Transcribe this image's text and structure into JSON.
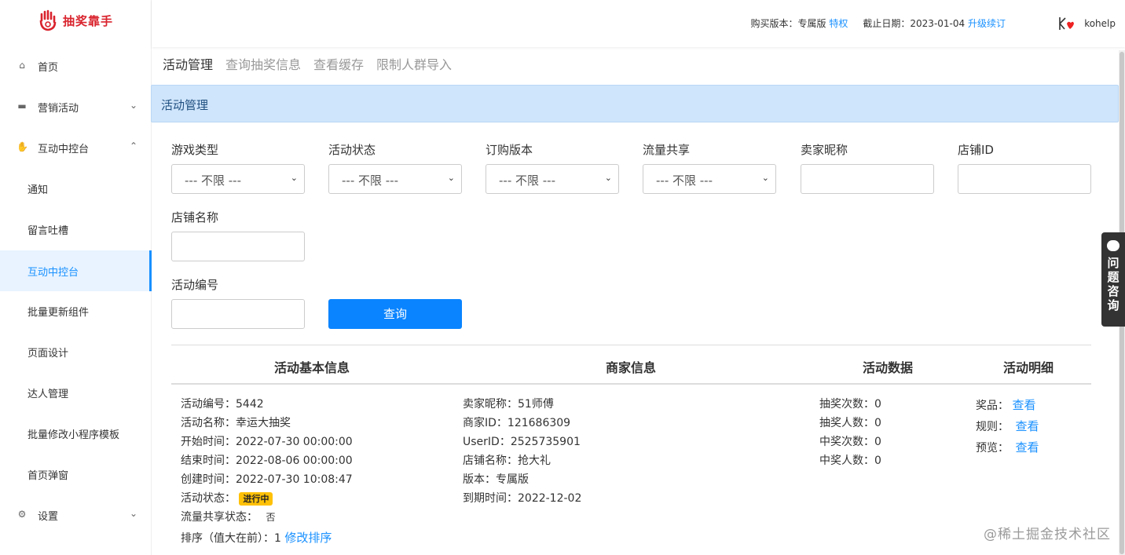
{
  "app": {
    "logo_text": "抽奖靠手"
  },
  "topbar": {
    "version_label": "购买版本：专属版",
    "privilege_link": "特权",
    "expire_label": "截止日期：2023-01-04",
    "renew_link": "升级续订",
    "username": "kohelp"
  },
  "sidebar": {
    "items": [
      {
        "label": "首页",
        "icon": "home-icon"
      },
      {
        "label": "营销活动",
        "icon": "briefcase-icon"
      },
      {
        "label": "互动中控台",
        "icon": "thumbs-up-icon"
      },
      {
        "label": "通知"
      },
      {
        "label": "留言吐槽"
      },
      {
        "label": "互动中控台"
      },
      {
        "label": "批量更新组件"
      },
      {
        "label": "页面设计"
      },
      {
        "label": "达人管理"
      },
      {
        "label": "批量修改小程序模板"
      },
      {
        "label": "首页弹窗"
      },
      {
        "label": "设置",
        "icon": "gear-icon"
      }
    ]
  },
  "tabs": [
    "活动管理",
    "查询抽奖信息",
    "查看缓存",
    "限制人群导入"
  ],
  "panel": {
    "title": "活动管理"
  },
  "filters": {
    "game_type": {
      "label": "游戏类型",
      "value": "--- 不限 ---"
    },
    "activity_status": {
      "label": "活动状态",
      "value": "--- 不限 ---"
    },
    "subscription_version": {
      "label": "订购版本",
      "value": "--- 不限 ---"
    },
    "traffic_share": {
      "label": "流量共享",
      "value": "--- 不限 ---"
    },
    "seller_nick": {
      "label": "卖家昵称",
      "value": ""
    },
    "shop_id": {
      "label": "店铺ID",
      "value": ""
    },
    "shop_name": {
      "label": "店铺名称",
      "value": ""
    },
    "activity_no": {
      "label": "活动编号",
      "value": ""
    },
    "query_button": "查询"
  },
  "table": {
    "headers": [
      "活动基本信息",
      "商家信息",
      "活动数据",
      "活动明细"
    ],
    "row": {
      "basic": {
        "activity_no": "活动编号：5442",
        "activity_name": "活动名称：幸运大抽奖",
        "start_time": "开始时间：2022-07-30 00:00:00",
        "end_time": "结束时间：2022-08-06 00:00:00",
        "created_time": "创建时间：2022-07-30 10:08:47",
        "status_label": "活动状态：",
        "status_badge": "进行中",
        "traffic_label": "流量共享状态：",
        "traffic_value": "否",
        "sort_label": "排序（值大在前）：1",
        "sort_link": "修改排序"
      },
      "merchant": {
        "nick": "卖家昵称：51师傅",
        "merchant_id": "商家ID：121686309",
        "user_id": "UserID：2525735901",
        "shop_name": "店铺名称：抢大礼",
        "version": "版本：专属版",
        "expire": "到期时间：2022-12-02"
      },
      "data": {
        "draw_times": "抽奖次数：0",
        "draw_people": "抽奖人数：0",
        "win_times": "中奖次数：0",
        "win_people": "中奖人数：0"
      },
      "detail": {
        "prize_label": "奖品：",
        "rule_label": "规则：",
        "preview_label": "预览：",
        "view_link": "查看"
      }
    }
  },
  "help_tab": "问题咨询",
  "watermark": "@稀土掘金技术社区"
}
